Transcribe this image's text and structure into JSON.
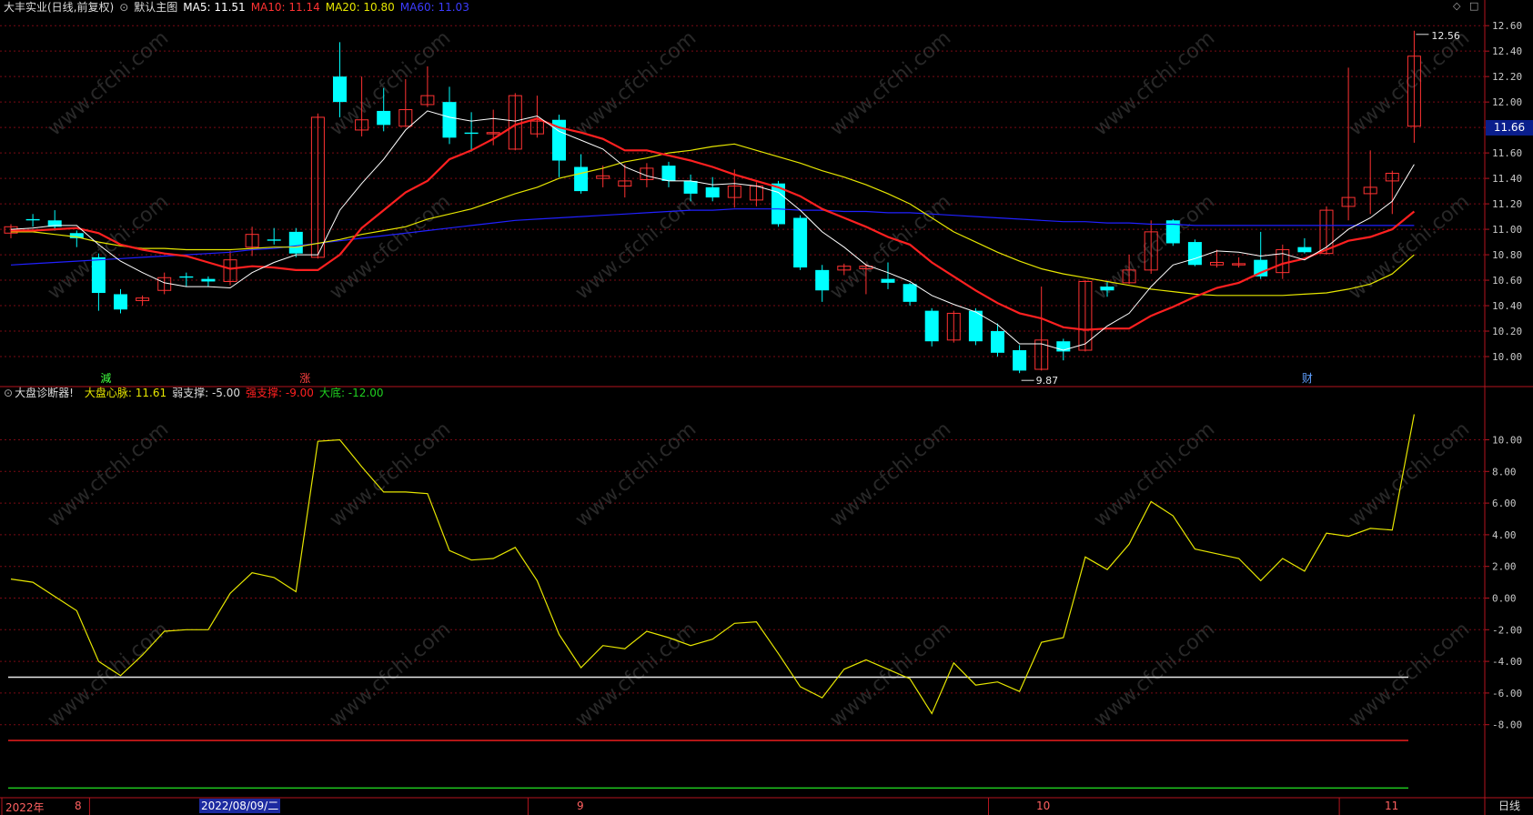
{
  "header": {
    "stock": "大丰实业(日线,前复权)",
    "main_indicator": "默认主图",
    "ma5": "MA5: 11.51",
    "ma10": "MA10: 11.14",
    "ma20": "MA20: 10.80",
    "ma60": "MA60: 11.03"
  },
  "sub_header": {
    "name": "大盘诊断器!",
    "heart": "大盘心脉: 11.61",
    "weak": "弱支撑: -5.00",
    "strong": "强支撑: -9.00",
    "bottom": "大底: -12.00"
  },
  "price_badge": "11.66",
  "high_label": "12.56",
  "low_label": "9.87",
  "period_button": "日线",
  "markers": {
    "reduce": "減",
    "rise": "涨",
    "finance": "财"
  },
  "xaxis": {
    "year": "2022年",
    "m8": "8",
    "cursor_date": "2022/08/09/二",
    "m9": "9",
    "m10": "10",
    "m11": "11"
  },
  "colors": {
    "up": "#ff3232",
    "down": "#00ffff",
    "ma5": "#ffffff",
    "ma10": "#ff2020",
    "ma20": "#e6e600",
    "ma60": "#2020ff",
    "heart": "#e6e600"
  },
  "watermark": "www.cfchi.com",
  "chart_data": [
    {
      "type": "candlestick",
      "ylim": [
        9.8,
        12.68
      ],
      "yticks": [
        "12.60",
        "12.40",
        "12.20",
        "12.00",
        "11.80",
        "11.60",
        "11.40",
        "11.20",
        "11.00",
        "10.80",
        "10.60",
        "10.40",
        "10.20",
        "10.00"
      ],
      "candles": [
        [
          10.97,
          11.02,
          10.93,
          11.04
        ],
        [
          11.08,
          11.07,
          11.02,
          11.12
        ],
        [
          11.07,
          11.02,
          10.99,
          11.15
        ],
        [
          10.97,
          10.93,
          10.86,
          10.99
        ],
        [
          10.78,
          10.5,
          10.36,
          10.81
        ],
        [
          10.49,
          10.37,
          10.34,
          10.53
        ],
        [
          10.44,
          10.46,
          10.4,
          10.48
        ],
        [
          10.52,
          10.62,
          10.49,
          10.66
        ],
        [
          10.63,
          10.62,
          10.55,
          10.66
        ],
        [
          10.61,
          10.59,
          10.55,
          10.63
        ],
        [
          10.59,
          10.76,
          10.56,
          10.83
        ],
        [
          10.86,
          10.96,
          10.79,
          11.02
        ],
        [
          10.92,
          10.91,
          10.88,
          11.01
        ],
        [
          10.98,
          10.81,
          10.78,
          11.01
        ],
        [
          10.78,
          11.88,
          10.77,
          11.91
        ],
        [
          12.2,
          12.0,
          11.88,
          12.47
        ],
        [
          11.78,
          11.86,
          11.73,
          12.2
        ],
        [
          11.93,
          11.82,
          11.77,
          12.11
        ],
        [
          11.81,
          11.94,
          11.81,
          12.18
        ],
        [
          11.98,
          12.05,
          11.96,
          12.28
        ],
        [
          12.0,
          11.72,
          11.67,
          12.12
        ],
        [
          11.76,
          11.75,
          11.61,
          11.92
        ],
        [
          11.75,
          11.76,
          11.66,
          11.94
        ],
        [
          11.63,
          12.05,
          11.62,
          12.07
        ],
        [
          11.75,
          11.85,
          11.72,
          12.05
        ],
        [
          11.86,
          11.54,
          11.41,
          11.9
        ],
        [
          11.49,
          11.3,
          11.28,
          11.59
        ],
        [
          11.4,
          11.42,
          11.33,
          11.5
        ],
        [
          11.34,
          11.38,
          11.25,
          11.51
        ],
        [
          11.39,
          11.48,
          11.33,
          11.52
        ],
        [
          11.5,
          11.38,
          11.33,
          11.53
        ],
        [
          11.38,
          11.28,
          11.22,
          11.43
        ],
        [
          11.33,
          11.25,
          11.22,
          11.41
        ],
        [
          11.25,
          11.34,
          11.17,
          11.47
        ],
        [
          11.23,
          11.34,
          11.18,
          11.37
        ],
        [
          11.36,
          11.04,
          11.02,
          11.38
        ],
        [
          11.09,
          10.7,
          10.68,
          11.11
        ],
        [
          10.68,
          10.52,
          10.43,
          10.72
        ],
        [
          10.68,
          10.71,
          10.64,
          10.73
        ],
        [
          10.69,
          10.71,
          10.49,
          10.73
        ],
        [
          10.61,
          10.58,
          10.53,
          10.74
        ],
        [
          10.57,
          10.43,
          10.4,
          10.58
        ],
        [
          10.36,
          10.12,
          10.08,
          10.38
        ],
        [
          10.13,
          10.34,
          10.11,
          10.36
        ],
        [
          10.36,
          10.12,
          10.09,
          10.38
        ],
        [
          10.2,
          10.03,
          10.0,
          10.26
        ],
        [
          10.05,
          9.89,
          9.87,
          10.09
        ],
        [
          9.9,
          10.13,
          9.89,
          10.55
        ],
        [
          10.12,
          10.04,
          9.97,
          10.14
        ],
        [
          10.05,
          10.59,
          10.04,
          10.6
        ],
        [
          10.55,
          10.52,
          10.47,
          10.59
        ],
        [
          10.58,
          10.68,
          10.57,
          10.8
        ],
        [
          10.68,
          10.98,
          10.65,
          11.07
        ],
        [
          11.07,
          10.89,
          10.87,
          11.08
        ],
        [
          10.9,
          10.72,
          10.71,
          10.92
        ],
        [
          10.72,
          10.74,
          10.7,
          10.84
        ],
        [
          10.72,
          10.73,
          10.7,
          10.78
        ],
        [
          10.76,
          10.63,
          10.61,
          10.98
        ],
        [
          10.66,
          10.84,
          10.61,
          10.88
        ],
        [
          10.86,
          10.82,
          10.81,
          10.93
        ],
        [
          10.81,
          11.15,
          10.8,
          11.18
        ],
        [
          11.18,
          11.25,
          11.07,
          12.27
        ],
        [
          11.28,
          11.33,
          11.12,
          11.62
        ],
        [
          11.38,
          11.44,
          11.12,
          11.46
        ],
        [
          11.81,
          12.36,
          11.68,
          12.56
        ]
      ],
      "ma5": [
        11.0,
        11.01,
        11.03,
        11.03,
        10.88,
        10.75,
        10.66,
        10.58,
        10.55,
        10.55,
        10.54,
        10.66,
        10.74,
        10.8,
        10.8,
        11.15,
        11.36,
        11.55,
        11.78,
        11.93,
        11.88,
        11.85,
        11.87,
        11.85,
        11.89,
        11.77,
        11.7,
        11.63,
        11.49,
        11.42,
        11.38,
        11.38,
        11.35,
        11.36,
        11.34,
        11.29,
        11.15,
        10.98,
        10.86,
        10.72,
        10.66,
        10.59,
        10.48,
        10.41,
        10.35,
        10.25,
        10.1,
        10.1,
        10.05,
        10.1,
        10.24,
        10.34,
        10.55,
        10.72,
        10.77,
        10.83,
        10.82,
        10.79,
        10.81,
        10.76,
        10.86,
        11.0,
        11.09,
        11.22,
        11.51
      ],
      "ma10": [
        10.99,
        10.99,
        11.0,
        11.01,
        10.97,
        10.88,
        10.84,
        10.81,
        10.79,
        10.74,
        10.69,
        10.71,
        10.7,
        10.68,
        10.68,
        10.8,
        11.01,
        11.15,
        11.29,
        11.38,
        11.55,
        11.62,
        11.71,
        11.82,
        11.87,
        11.8,
        11.76,
        11.71,
        11.62,
        11.62,
        11.58,
        11.54,
        11.49,
        11.43,
        11.38,
        11.33,
        11.26,
        11.16,
        11.09,
        11.02,
        10.94,
        10.88,
        10.74,
        10.63,
        10.52,
        10.42,
        10.34,
        10.3,
        10.23,
        10.21,
        10.22,
        10.22,
        10.32,
        10.39,
        10.47,
        10.54,
        10.58,
        10.66,
        10.73,
        10.77,
        10.84,
        10.91,
        10.94,
        11.0,
        11.14
      ],
      "ma20": [
        10.98,
        10.98,
        10.96,
        10.94,
        10.9,
        10.87,
        10.85,
        10.85,
        10.84,
        10.84,
        10.84,
        10.85,
        10.86,
        10.86,
        10.89,
        10.92,
        10.96,
        10.99,
        11.02,
        11.08,
        11.12,
        11.16,
        11.22,
        11.28,
        11.33,
        11.4,
        11.44,
        11.48,
        11.53,
        11.56,
        11.6,
        11.62,
        11.65,
        11.67,
        11.62,
        11.57,
        11.52,
        11.46,
        11.41,
        11.35,
        11.28,
        11.2,
        11.09,
        10.98,
        10.9,
        10.82,
        10.75,
        10.69,
        10.65,
        10.62,
        10.59,
        10.56,
        10.53,
        10.51,
        10.49,
        10.48,
        10.48,
        10.48,
        10.48,
        10.49,
        10.5,
        10.53,
        10.57,
        10.65,
        10.8
      ],
      "ma60": [
        10.72,
        10.73,
        10.74,
        10.75,
        10.76,
        10.77,
        10.78,
        10.79,
        10.8,
        10.81,
        10.82,
        10.84,
        10.85,
        10.87,
        10.89,
        10.91,
        10.93,
        10.95,
        10.97,
        10.99,
        11.01,
        11.03,
        11.05,
        11.07,
        11.08,
        11.09,
        11.1,
        11.11,
        11.12,
        11.13,
        11.14,
        11.15,
        11.15,
        11.16,
        11.16,
        11.16,
        11.15,
        11.15,
        11.14,
        11.14,
        11.13,
        11.13,
        11.12,
        11.11,
        11.1,
        11.09,
        11.08,
        11.07,
        11.06,
        11.06,
        11.05,
        11.05,
        11.04,
        11.04,
        11.03,
        11.03,
        11.03,
        11.03,
        11.03,
        11.03,
        11.03,
        11.03,
        11.03,
        11.03,
        11.03
      ]
    },
    {
      "type": "line",
      "name": "大盘心脉",
      "ylim": [
        -12.5,
        12.5
      ],
      "yticks": [
        "10.00",
        "8.00",
        "6.00",
        "4.00",
        "2.00",
        "0.00",
        "-2.00",
        "-4.00",
        "-6.00",
        "-8.00"
      ],
      "values": [
        1.2,
        1.0,
        0.1,
        -0.8,
        -4.0,
        -4.9,
        -3.6,
        -2.1,
        -2.0,
        -2.0,
        0.3,
        1.6,
        1.3,
        0.4,
        9.9,
        10.0,
        8.3,
        6.7,
        6.7,
        6.6,
        3.0,
        2.4,
        2.5,
        3.2,
        1.1,
        -2.3,
        -4.4,
        -3.0,
        -3.2,
        -2.1,
        -2.5,
        -3.0,
        -2.6,
        -1.6,
        -1.5,
        -3.5,
        -5.6,
        -6.3,
        -4.5,
        -3.9,
        -4.5,
        -5.1,
        -7.3,
        -4.1,
        -5.5,
        -5.3,
        -5.9,
        -2.8,
        -2.5,
        2.6,
        1.8,
        3.4,
        6.1,
        5.2,
        3.1,
        2.8,
        2.5,
        1.1,
        2.5,
        1.7,
        4.1,
        3.9,
        4.4,
        4.3,
        11.61
      ],
      "hlines": [
        -5.0,
        -9.0,
        -12.0
      ]
    }
  ]
}
